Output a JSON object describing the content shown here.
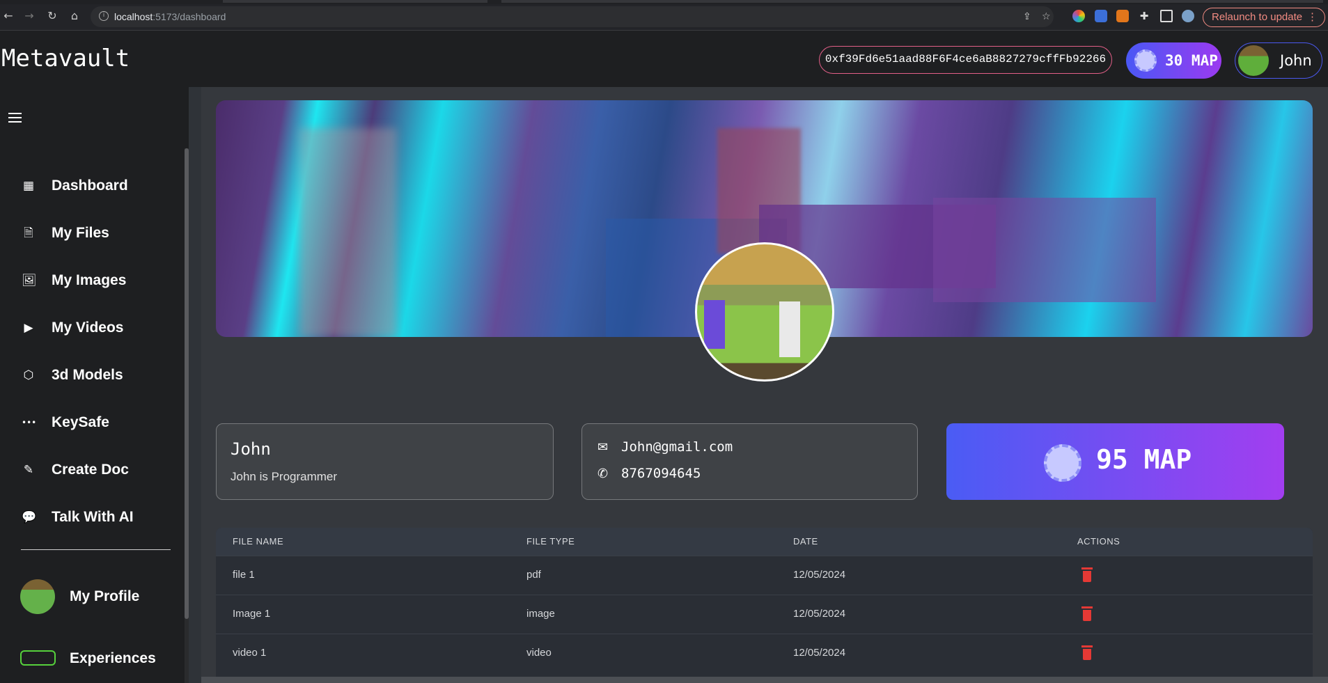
{
  "browser": {
    "url_host": "localhost",
    "url_path": ":5173/dashboard",
    "relaunch_label": "Relaunch to update",
    "relaunch_menu": "⋮",
    "icons": {
      "back": "back-arrow-icon",
      "forward": "forward-arrow-icon",
      "reload": "reload-icon",
      "home": "home-icon",
      "info": "info-icon",
      "share": "share-icon",
      "bookmark": "star-icon"
    }
  },
  "app": {
    "logo": "Metavault",
    "wallet_address": "0xf39Fd6e51aad88F6F4ce6aB8827279cffFb92266",
    "map_balance_label": "30 MAP",
    "user_name": "John"
  },
  "sidebar": {
    "items": [
      {
        "label": "Dashboard",
        "icon": "dashboard-icon",
        "glyph": "▦"
      },
      {
        "label": "My Files",
        "icon": "file-icon",
        "glyph": "🗎"
      },
      {
        "label": "My Images",
        "icon": "image-icon",
        "glyph": "🖼"
      },
      {
        "label": "My Videos",
        "icon": "video-icon",
        "glyph": "▶"
      },
      {
        "label": "3d Models",
        "icon": "cube-icon",
        "glyph": "⬡"
      },
      {
        "label": "KeySafe",
        "icon": "password-icon",
        "glyph": "•••"
      },
      {
        "label": "Create Doc",
        "icon": "doc-edit-icon",
        "glyph": "✎"
      },
      {
        "label": "Talk With AI",
        "icon": "chat-icon",
        "glyph": "💬"
      }
    ],
    "profile_label": "My Profile",
    "experiences_label": "Experiences"
  },
  "profile": {
    "name": "John",
    "bio": "John is Programmer",
    "email": "John@gmail.com",
    "phone": "8767094645",
    "balance": "95 MAP"
  },
  "files_table": {
    "headers": [
      "FILE NAME",
      "FILE TYPE",
      "DATE",
      "ACTIONS"
    ],
    "rows": [
      {
        "name": "file 1",
        "type": "pdf",
        "date": "12/05/2024"
      },
      {
        "name": "Image 1",
        "type": "image",
        "date": "12/05/2024"
      },
      {
        "name": "video 1",
        "type": "video",
        "date": "12/05/2024"
      }
    ]
  },
  "colors": {
    "accent_blue": "#4a58f5",
    "accent_purple": "#9b3af0",
    "delete_red": "#e53935",
    "wallet_border": "#e35f88"
  }
}
